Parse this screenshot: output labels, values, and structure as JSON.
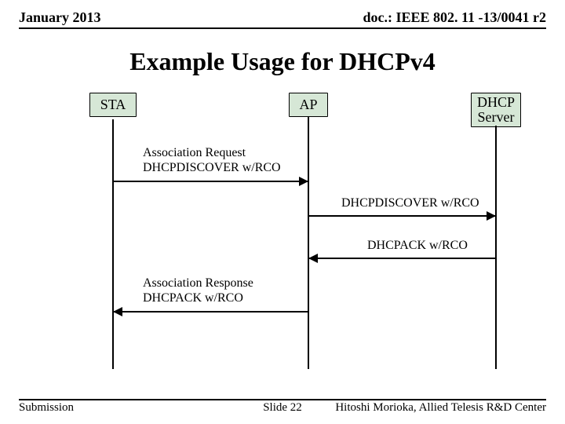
{
  "header": {
    "date": "January 2013",
    "docref": "doc.: IEEE 802. 11 -13/0041 r2"
  },
  "title": "Example Usage for DHCPv4",
  "nodes": {
    "sta": "STA",
    "ap": "AP",
    "server": "DHCP\nServer"
  },
  "messages": {
    "m1a": "Association Request",
    "m1b": "DHCPDISCOVER w/RCO",
    "m2": "DHCPDISCOVER w/RCO",
    "m3": "DHCPACK w/RCO",
    "m4a": "Association Response",
    "m4b": "DHCPACK w/RCO"
  },
  "footer": {
    "left": "Submission",
    "center": "Slide 22",
    "right": "Hitoshi Morioka, Allied Telesis R&D Center"
  }
}
